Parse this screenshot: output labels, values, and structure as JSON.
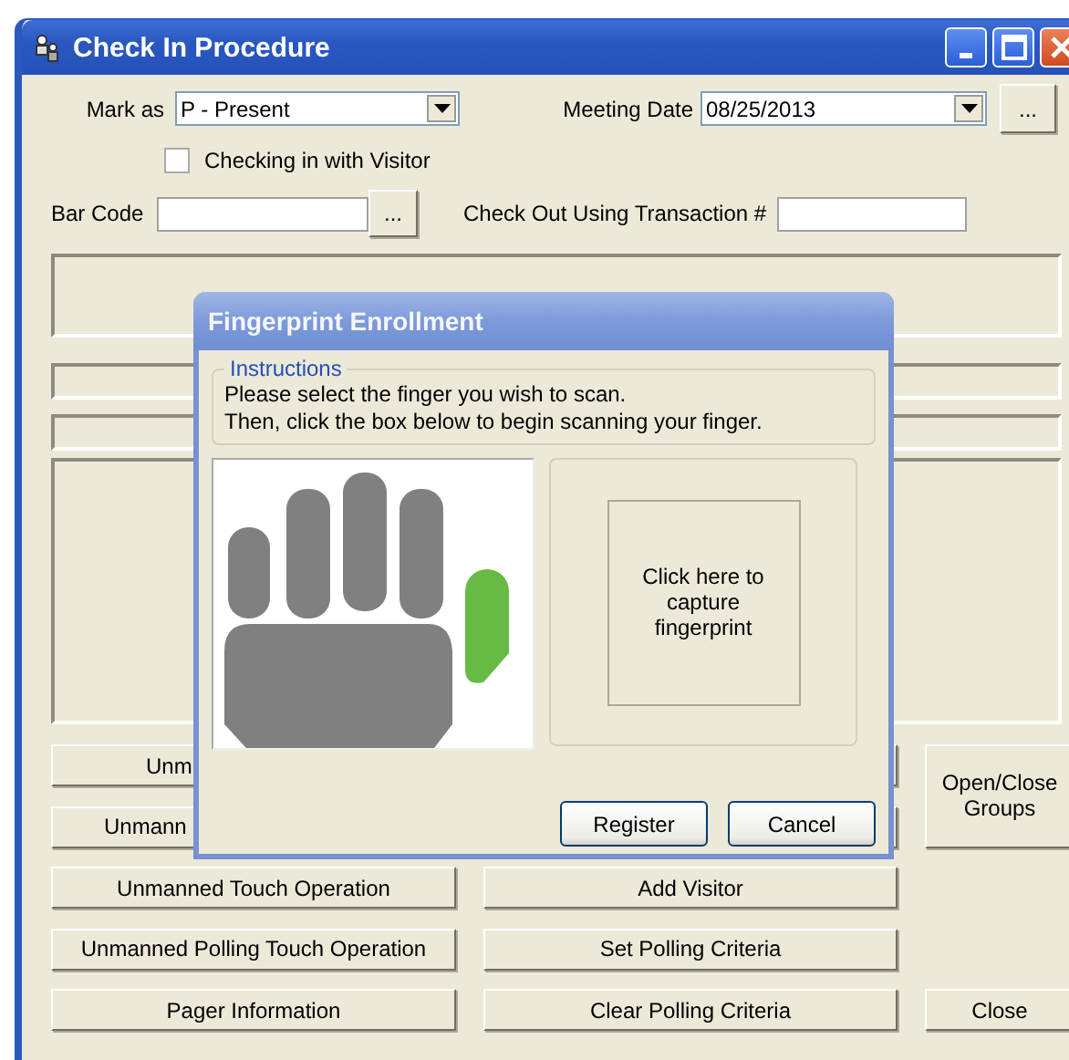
{
  "window": {
    "title": "Check In Procedure"
  },
  "mark_as": {
    "label": "Mark as",
    "value": "P - Present"
  },
  "meeting_date": {
    "label": "Meeting Date",
    "value": "08/25/2013",
    "button": "..."
  },
  "visitor_checkbox": {
    "label": "Checking in with Visitor",
    "checked": false
  },
  "bar_code": {
    "label": "Bar Code",
    "button": "..."
  },
  "check_out": {
    "label": "Check Out Using Transaction #"
  },
  "left_buttons": [
    "Unm",
    "Unmann",
    "Unmanned Touch Operation",
    "Unmanned Polling Touch Operation",
    "Pager Information"
  ],
  "middle_buttons": [
    "Add Visitor",
    "Set Polling Criteria",
    "Clear Polling Criteria"
  ],
  "right_buttons": [
    "Open/Close Groups",
    "Close"
  ],
  "dialog": {
    "title": "Fingerprint Enrollment",
    "group_title": "Instructions",
    "instructions": [
      "Please select the finger you wish to scan.",
      "Then, click the box below to begin scanning your finger."
    ],
    "fingers": [
      {
        "selected": false
      },
      {
        "selected": false
      },
      {
        "selected": false
      },
      {
        "selected": false
      },
      {
        "selected": true
      }
    ],
    "capture_text": "Click here to capture fingerprint",
    "buttons": [
      "Register",
      "Cancel"
    ]
  }
}
